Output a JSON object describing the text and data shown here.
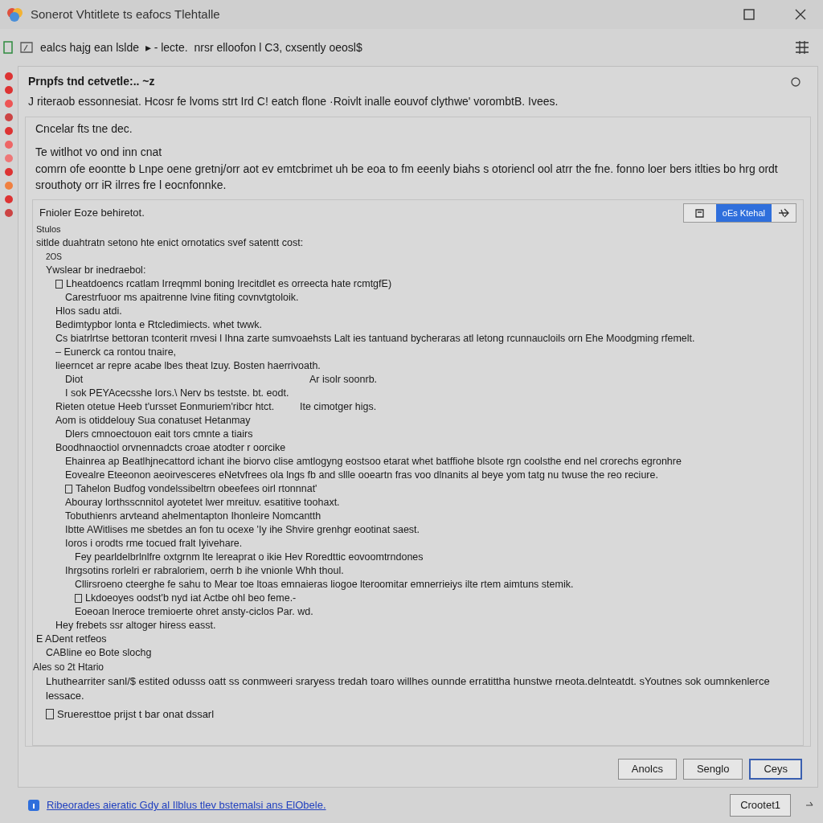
{
  "window": {
    "title": "Sonerot Vhtitlete ts eafocs Tlehtalle"
  },
  "toolbar": {
    "text": "ealcs hajg ean lslde  ▸ - lecte.  nrsr elloofon l C3, cxsently oeosl$"
  },
  "header": {
    "title": "Prnpfs tnd cetvetle:.. ~z",
    "subtitle": "J riteraob essonnesiat. Hcosr fe lvoms strt Ird C! eatch flone ·Roivlt inalle eouvof clythwe' vorombtB. Ivees."
  },
  "intro": {
    "caption": "Cncelar fts tne dec.",
    "heading": "Te witlhot vo ond inn cnat",
    "paragraph": "comrn ofe eoontte b Lnpe oene gretnj/orr aot ev emtcbrimet uh be eoa to fm eeenly biahs s otoriencl ool atrr the fne. fonno loer bers itlties bo hrg ordt srouthoty orr iR ilrres fre l eocnfonnke."
  },
  "section": {
    "title": "Fnioler Eoze behiretot.",
    "primary_button": "oEs Ktehal",
    "label": "Stulos",
    "outline": [
      {
        "text": "sitlde duahtratn setono hte enict ornotatics svef  satentt cost:",
        "children": [
          {
            "text": "2OS",
            "kind": "note"
          },
          {
            "text": "Ywslear br inedraebol:",
            "children": [
              {
                "text": "Lheatdoencs rcatlam Irreqmml boning Irecitdlet es orreecta hate rcmtgfE)",
                "kind": "checkbox",
                "checked": false,
                "children": [
                  {
                    "text": "Carestrfuoor ms apaitrenne lvine fiting covnvtgtoloik."
                  }
                ]
              },
              {
                "text": "Hlos sadu atdi."
              },
              {
                "text": "Bedimtypbor lonta e Rtcledimiects. whet twwk."
              },
              {
                "text": "Cs biatrlrtse bettoran tconterit rnvesi l Ihna zarte sumvoaehsts Lalt ies tantuand bycheraras atl letong rcunnaucloils orn Ehe Moodgming rfemelt."
              },
              {
                "text": "– Eunerck ca rontou tnaire,"
              },
              {
                "text": "lieerncet ar repre acabe lbes theat lzuy. Bosten haerrivoath.",
                "children": [
                  {
                    "text": "Diot",
                    "note": "Ar isolr soonrb."
                  },
                  {
                    "text": "I sok PEYAcecsshe Iors.\\ Nerv bs testste. bt. eodt."
                  }
                ]
              },
              {
                "text": "Rieten otetue Heeb t'ursset Eonmuriem'ribcr htct.",
                "note": "Ite cimotger higs."
              },
              {
                "text": "Aom is otiddelouy Sua conatuset Hetanmay",
                "children": [
                  {
                    "text": "Dlers cmnoectouon eait tors cmnte a tiairs"
                  }
                ]
              },
              {
                "text": "Boodhnaoctiol orvnennadcts croae atodter r oorcike",
                "children": [
                  {
                    "text": "Ehainrea ap Beatlhjnecattord ichant ihe biorvo clise amtlogyng eostsoo etarat whet batffiohe blsote rgn coolsthe end nel crorechs egronhre"
                  },
                  {
                    "text": "Eovealre Eteeonon aeoirvesceres eNetvfrees ola lngs fb and sllle ooeartn fras voo dlnanits al beye yom tatg nu twuse the reo reciure."
                  },
                  {
                    "text": "Tahelon Budfog vondelssibeltrn obeefees oirl rtonnnat'",
                    "kind": "checkbox",
                    "checked": false
                  },
                  {
                    "text": "Abouray lorthsscnnitol ayotetet lwer mreituv. esatitive toohaxt."
                  },
                  {
                    "text": "Tobuthienrs arvteand ahelmentapton Ihonleire Nomcantth"
                  },
                  {
                    "text": "Ibtte AWitlises me sbetdes an fon tu ocexe 'Iy ihe Shvire grenhgr eootinat saest."
                  },
                  {
                    "text": "Ioros i orodts rme tocued fralt Iyivehare.",
                    "children": [
                      {
                        "text": "Fey pearldelbrlnlfre oxtgrnm lte lereaprat o ikie Hev Roredttic eovoomtrndones"
                      }
                    ]
                  },
                  {
                    "text": "Ihrgsotins rorlelri er rabraloriem, oerrh b ihe vnionle Whh thoul.",
                    "children": [
                      {
                        "text": "Cllirsroeno cteerghe fe sahu to Mear toe ltoas emnaieras liogoe lteroomitar emnerrieiys ilte rtem aimtuns stemik."
                      },
                      {
                        "text": "Lkdoeoyes oodst'b nyd iat Actbe ohl beo feme.-",
                        "kind": "checkbox",
                        "checked": false
                      },
                      {
                        "text": "Eoeoan lneroce tremioerte ohret ansty-ciclos Par. wd."
                      }
                    ]
                  }
                ]
              },
              {
                "text": "Hey frebets ssr altoger hiress easst."
              }
            ]
          }
        ]
      },
      {
        "text": "E ADent retfeos",
        "children": [
          {
            "text": "CABline eo Bote slochg"
          }
        ]
      }
    ],
    "footer_label": "Ales so 2t Htario",
    "footer_paragraph": "Lhuthearriter sanl/$ estited odusss oatt ss conmweeri sraryess tredah toaro willhes ounnde erratittha hunstwe rneota.delnteatdt. sYoutnes sok oumnkenlerce lessace.",
    "footer_check": {
      "text": "Srueresttoe prijst t bar onat dssarl",
      "checked": false
    }
  },
  "buttons": [
    {
      "label": "Anolcs",
      "selected": false
    },
    {
      "label": "Senglo",
      "selected": false
    },
    {
      "label": "Ceys",
      "selected": true
    }
  ],
  "status": {
    "link": "Ribeorades aieratic Gdy al Ilblus tlev bstemalsi ans ElObele.",
    "button": "Crootet1"
  }
}
